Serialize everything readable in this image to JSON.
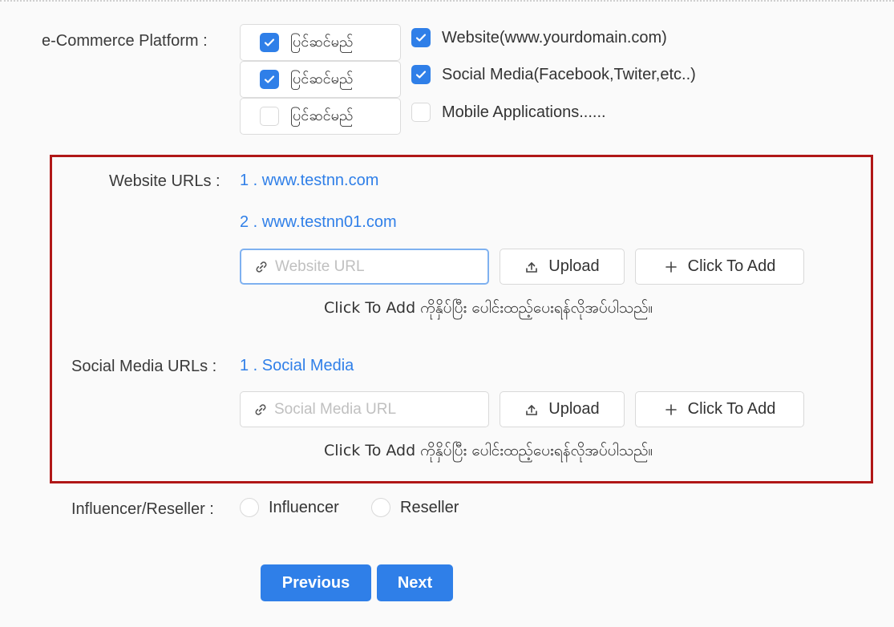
{
  "form": {
    "platform_label": "e-Commerce Platform :",
    "publish_rows": [
      {
        "label": "ပြင်ဆင်မည်",
        "checked": true,
        "option": "Website(www.yourdomain.com)",
        "option_checked": true
      },
      {
        "label": "ပြင်ဆင်မည်",
        "checked": true,
        "option": "Social Media(Facebook,Twiter,etc..)",
        "option_checked": true
      },
      {
        "label": "ပြင်ဆင်မည်",
        "checked": false,
        "option": "Mobile Applications......",
        "option_checked": false
      }
    ],
    "website": {
      "label": "Website URLs :",
      "links": [
        "1 . www.testnn.com",
        "2 . www.testnn01.com"
      ],
      "placeholder": "Website URL",
      "upload_label": "Upload",
      "add_label": "Click To Add",
      "hint": "Click To Add ကိုနှိပ်ပြီး ပေါင်းထည့်ပေးရန်လိုအပ်ပါသည်။"
    },
    "social": {
      "label": "Social Media URLs :",
      "links": [
        "1 . Social Media"
      ],
      "placeholder": "Social Media URL",
      "upload_label": "Upload",
      "add_label": "Click To Add",
      "hint": "Click To Add ကိုနှိပ်ပြီး ပေါင်းထည့်ပေးရန်လိုအပ်ပါသည်။"
    },
    "influencer": {
      "label": "Influencer/Reseller :",
      "options": [
        "Influencer",
        "Reseller"
      ]
    },
    "previous_label": "Previous",
    "next_label": "Next"
  },
  "colors": {
    "accent": "#2f7fe8",
    "highlight_frame": "#b01717"
  },
  "icons": {
    "check": "check-icon",
    "link": "link-icon",
    "upload": "upload-icon",
    "plus": "plus-icon"
  }
}
